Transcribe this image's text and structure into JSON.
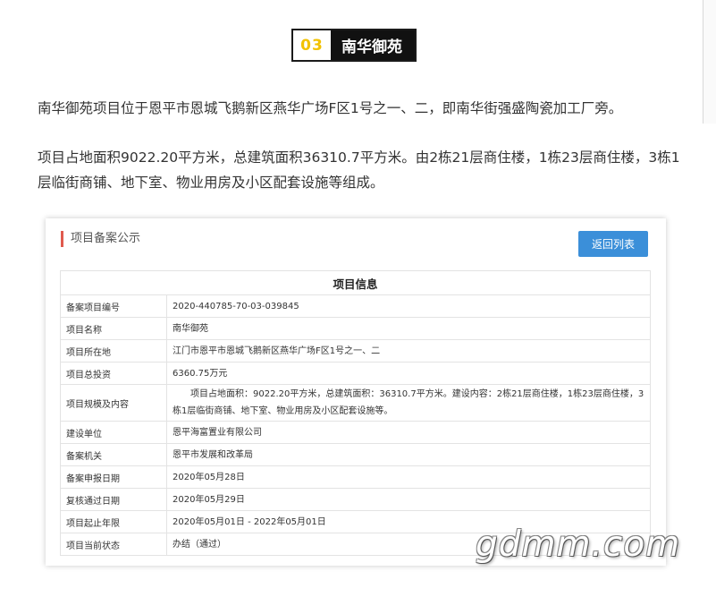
{
  "heading": {
    "number": "03",
    "title": "南华御苑"
  },
  "paragraphs": [
    "南华御苑项目位于恩平市恩城飞鹅新区燕华广场F区1号之一、二，即南华街强盛陶瓷加工厂旁。",
    "项目占地面积9022.20平方米，总建筑面积36310.7平方米。由2栋21层商住楼，1栋23层商住楼，3栋1层临街商铺、地下室、物业用房及小区配套设施等组成。"
  ],
  "card": {
    "header": "项目备案公示",
    "back_button": "返回列表",
    "table_title": "项目信息",
    "rows": [
      {
        "label": "备案项目编号",
        "value": "2020-440785-70-03-039845"
      },
      {
        "label": "项目名称",
        "value": "南华御苑"
      },
      {
        "label": "项目所在地",
        "value": "江门市恩平市恩城飞鹅新区燕华广场F区1号之一、二"
      },
      {
        "label": "项目总投资",
        "value": "6360.75万元"
      },
      {
        "label": "项目规模及内容",
        "value": "项目占地面积：9022.20平方米，总建筑面积：36310.7平方米。建设内容：2栋21层商住楼，1栋23层商住楼，3栋1层临街商铺、地下室、物业用房及小区配套设施等。"
      },
      {
        "label": "建设单位",
        "value": "恩平海富置业有限公司"
      },
      {
        "label": "备案机关",
        "value": "恩平市发展和改革局"
      },
      {
        "label": "备案申报日期",
        "value": "2020年05月28日"
      },
      {
        "label": "复核通过日期",
        "value": "2020年05月29日"
      },
      {
        "label": "项目起止年限",
        "value": "2020年05月01日 - 2022年05月01日"
      },
      {
        "label": "项目当前状态",
        "value": "办结（通过）"
      }
    ]
  },
  "watermark": "gdmm.com"
}
